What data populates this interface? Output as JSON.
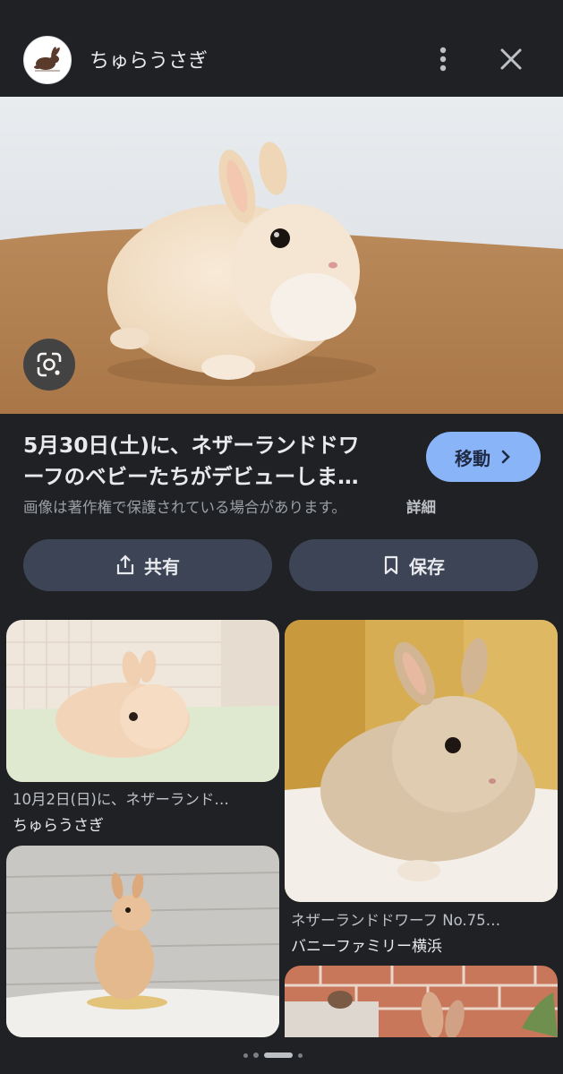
{
  "header": {
    "site_name": "ちゅらうさぎ"
  },
  "result": {
    "title_line1": "5月30日(土)に、ネザーランドドワ",
    "title_line2": "ーフのベビーたちがデビューしま…",
    "visit_label": "移動",
    "copyright_note": "画像は著作権で保護されている場合があります。",
    "details_link": "詳細",
    "share_label": "共有",
    "save_label": "保存"
  },
  "related": [
    {
      "caption": "10月2日(日)に、ネザーランド…",
      "source": "ちゅらうさぎ"
    },
    {
      "caption": "ネザーランドドワーフ No.75…",
      "source": "バニーファミリー横浜"
    }
  ],
  "pager": {
    "count": 4,
    "active_index": 2
  },
  "colors": {
    "background": "#202124",
    "accent": "#8ab4f8",
    "pill": "#3c4455"
  }
}
